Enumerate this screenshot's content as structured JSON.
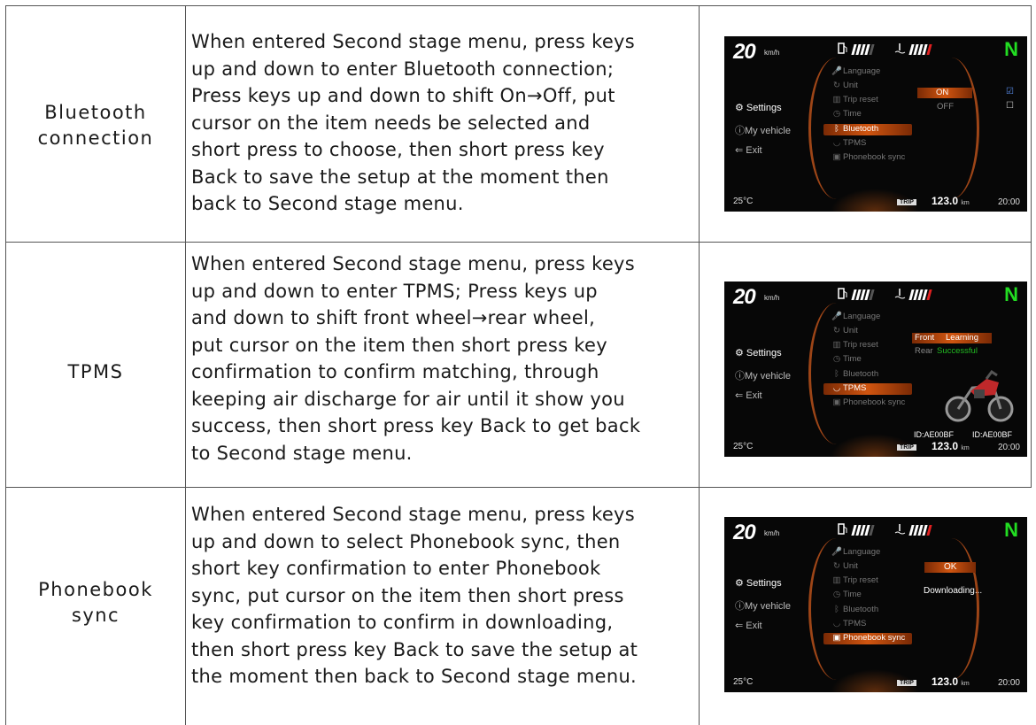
{
  "rows": [
    {
      "label_lines": [
        "Bluetooth",
        "connection"
      ],
      "desc_lines": [
        "When entered Second stage menu, press keys",
        "up and down to enter Bluetooth connection;",
        "Press keys up and down to shift On→Off, put",
        "cursor on the item needs be selected and",
        "short press to choose, then short press key",
        "Back to save the setup at the moment then",
        "back to Second stage menu."
      ]
    },
    {
      "label_lines": [
        "TPMS"
      ],
      "desc_lines": [
        "When entered Second stage menu, press keys",
        "up and down to enter TPMS; Press keys up",
        "and down to shift front wheel→rear wheel,",
        "put cursor on the item then short press key",
        "confirmation to confirm matching, through",
        "keeping air discharge for air until it show you",
        "success, then short press key Back to get back",
        "to Second stage menu."
      ]
    },
    {
      "label_lines": [
        "Phonebook",
        "sync"
      ],
      "desc_lines": [
        "When entered Second stage menu, press keys",
        "up and down to select Phonebook sync, then",
        "short key confirmation to enter Phonebook",
        "sync, put cursor on the item then short press",
        "key confirmation to confirm in downloading,",
        "then short press key Back to save the setup at",
        "the moment then back to Second stage menu."
      ]
    }
  ],
  "dash": {
    "speed": "20",
    "speed_unit": "km/h",
    "gear": "N",
    "left_menu": [
      "Settings",
      "My vehicle",
      "Exit"
    ],
    "mid_menu": [
      "Language",
      "Unit",
      "Trip reset",
      "Time",
      "Bluetooth",
      "TPMS",
      "Phonebook sync"
    ],
    "temp": "25°C",
    "trip_label": "TRIP",
    "odo": "123.0",
    "odo_unit": "km",
    "clock": "20:00",
    "bt_on": "ON",
    "bt_off": "OFF",
    "tpms_front": "Front",
    "tpms_learning": "Learning",
    "tpms_rear": "Rear",
    "tpms_successful": "Successful",
    "tpms_id1": "ID:AE00BF",
    "tpms_id2": "ID:AE00BF",
    "pb_ok": "OK",
    "pb_downloading": "Downloading..."
  }
}
